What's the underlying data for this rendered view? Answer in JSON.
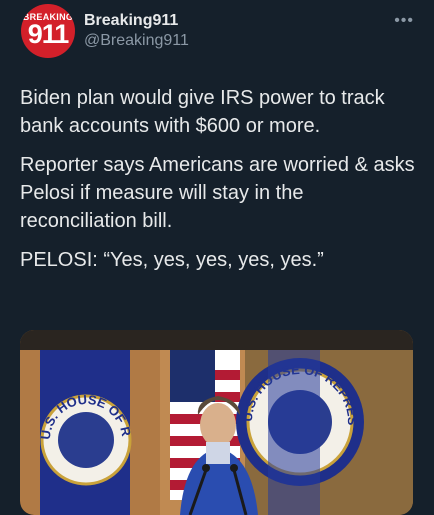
{
  "tweet": {
    "author": {
      "display_name": "Breaking911",
      "handle": "@Breaking911",
      "avatar_top_text": "BREAKING",
      "avatar_number": "911"
    },
    "more_icon": "more-icon",
    "paragraphs": [
      "Biden plan would give IRS power to track bank accounts with $600 or more.",
      "Reporter says Americans are worried & asks Pelosi if measure will stay in the reconciliation bill.",
      "PELOSI: “Yes, yes, yes, yes, yes.”"
    ],
    "media": {
      "banner_left_text": "U.S. HOUSE OF REPRESENTATIVES",
      "seal_right_text": "U.S. HOUSE OF REPRESENTATIVES"
    }
  },
  "colors": {
    "background": "#15202b",
    "text": "#e7e9ea",
    "muted": "#8b98a5",
    "avatar_red": "#d3202a"
  }
}
